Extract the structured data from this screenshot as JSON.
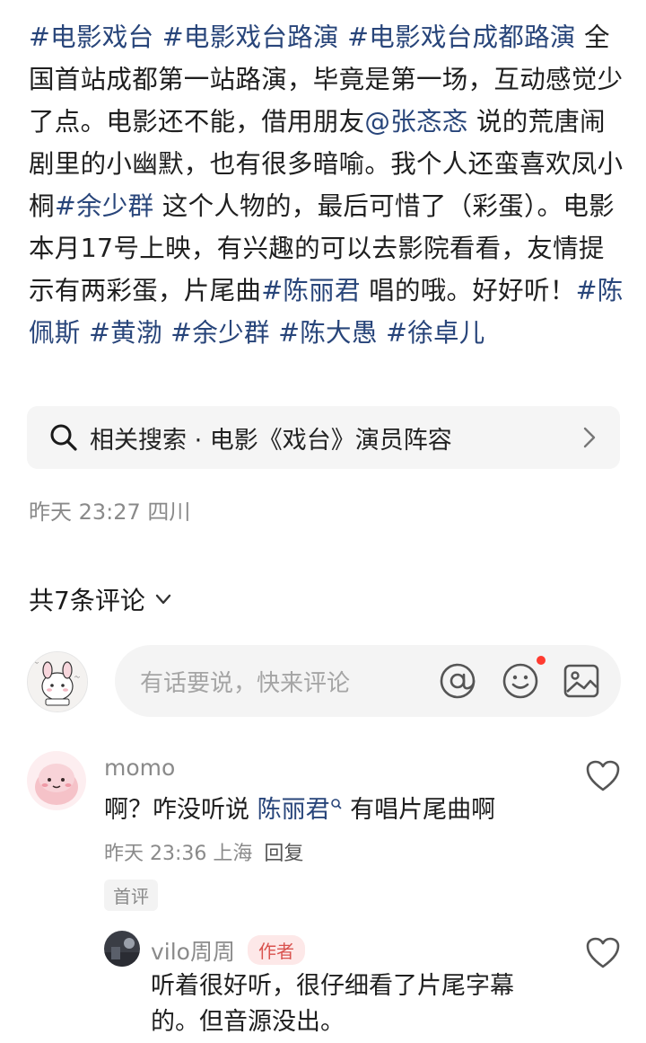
{
  "post": {
    "segments": [
      {
        "text": "#电影戏台",
        "type": "tag"
      },
      {
        "text": " ",
        "type": "text"
      },
      {
        "text": "#电影戏台路演",
        "type": "tag"
      },
      {
        "text": " ",
        "type": "text"
      },
      {
        "text": "#电影戏台成都路演",
        "type": "tag"
      },
      {
        "text": " 全国首站成都第一站路演，毕竟是第一场，互动感觉少了点。电影还不能，借用朋友",
        "type": "text"
      },
      {
        "text": "@张忞忞",
        "type": "mention"
      },
      {
        "text": " 说的荒唐闹剧里的小幽默，也有很多暗喻。我个人还蛮喜欢凤小桐",
        "type": "text"
      },
      {
        "text": "#余少群",
        "type": "tag"
      },
      {
        "text": " 这个人物的，最后可惜了（彩蛋）。电影本月17号上映，有兴趣的可以去影院看看，友情提示有两彩蛋，片尾曲",
        "type": "text"
      },
      {
        "text": "#陈丽君",
        "type": "tag"
      },
      {
        "text": " 唱的哦。好好听！",
        "type": "text"
      },
      {
        "text": "#陈佩斯",
        "type": "tag"
      },
      {
        "text": " ",
        "type": "text"
      },
      {
        "text": "#黄渤",
        "type": "tag"
      },
      {
        "text": " ",
        "type": "text"
      },
      {
        "text": "#余少群",
        "type": "tag"
      },
      {
        "text": " ",
        "type": "text"
      },
      {
        "text": "#陈大愚",
        "type": "tag"
      },
      {
        "text": " ",
        "type": "text"
      },
      {
        "text": "#徐卓儿",
        "type": "tag"
      }
    ]
  },
  "related_search": {
    "icon": "search-icon",
    "label": "相关搜索 · 电影《戏台》演员阵容",
    "chevron_icon": "chevron-right-icon"
  },
  "post_meta": "昨天 23:27 四川",
  "comments_header": {
    "label": "共7条评论",
    "chevron_icon": "chevron-down-icon"
  },
  "comment_input": {
    "placeholder": "有话要说，快来评论",
    "icons": [
      "at-icon",
      "emoji-icon",
      "image-icon"
    ]
  },
  "comments": [
    {
      "user": "momo",
      "text_prefix": "啊？咋没听说 ",
      "link": "陈丽君",
      "text_suffix": " 有唱片尾曲啊",
      "time": "昨天 23:36",
      "location": "上海",
      "reply": "回复",
      "badge": "首评"
    },
    {
      "user": "vilo周周",
      "author_badge": "作者",
      "text_line1": "听着很好听，很仔细看了片尾字幕",
      "text_line2": "的。但音源没出。"
    }
  ],
  "colors": {
    "link": "#28457a",
    "meta_gray": "#8a8a8a",
    "author_red": "#d9534f",
    "notification_dot": "#ff3b30"
  }
}
